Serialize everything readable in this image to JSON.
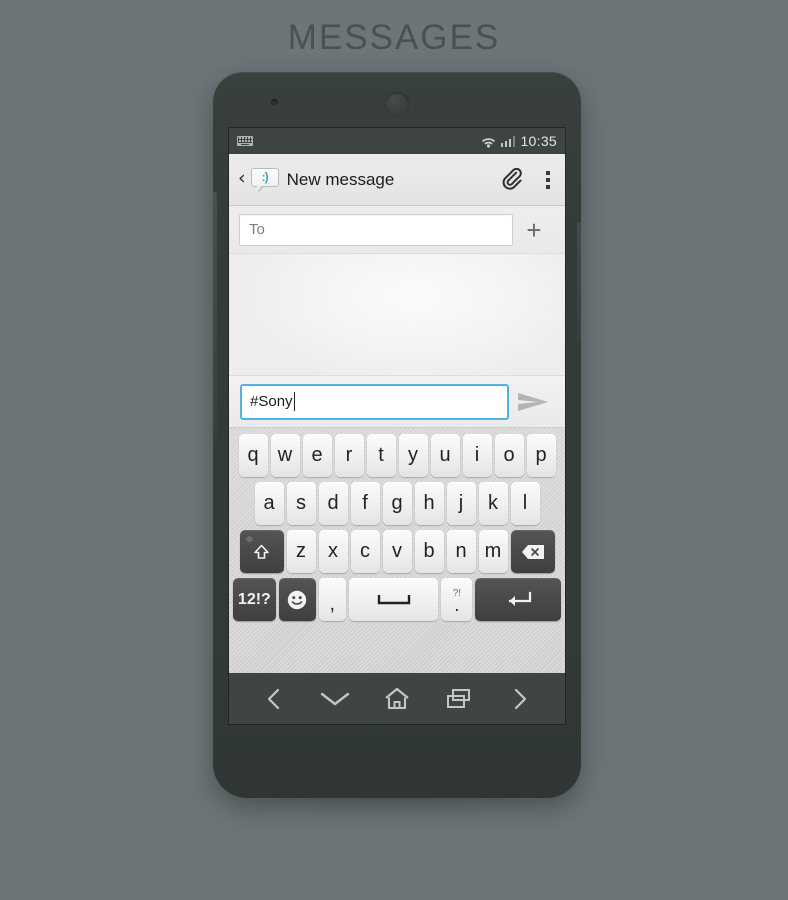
{
  "page": {
    "title": "MESSAGES",
    "background_color": "#6d7578",
    "phone_body_color": "#353c3a"
  },
  "statusbar": {
    "keyboard_icon": "keyboard-icon",
    "wifi_icon": "wifi-icon",
    "signal_icon": "signal-bars-icon",
    "time": "10:35"
  },
  "appbar": {
    "back_icon": "back-chevron-icon",
    "app_icon": "message-bubble-icon",
    "app_icon_face": ":)",
    "title": "New message",
    "attach_icon": "paperclip-icon",
    "overflow_icon": "overflow-menu-icon"
  },
  "recipient": {
    "placeholder": "To",
    "value": "",
    "add_contact_label": "+"
  },
  "compose": {
    "value": "#Sony",
    "send_icon": "send-arrow-icon",
    "accent_color": "#4fb3e8"
  },
  "keyboard": {
    "row1": [
      "q",
      "w",
      "e",
      "r",
      "t",
      "y",
      "u",
      "i",
      "o",
      "p"
    ],
    "row2": [
      "a",
      "s",
      "d",
      "f",
      "g",
      "h",
      "j",
      "k",
      "l"
    ],
    "row3": [
      "z",
      "x",
      "c",
      "v",
      "b",
      "n",
      "m"
    ],
    "shift_icon": "shift-arrow-icon",
    "backspace_icon": "backspace-icon",
    "symbols_label": "12!?",
    "emoji_icon": "smiley-icon",
    "comma_label": ",",
    "space_icon": "spacebar-icon",
    "period_top_label": "?!",
    "period_label": ".",
    "enter_icon": "enter-return-icon"
  },
  "navbar": {
    "back_icon": "nav-back-icon",
    "hide_keyboard_icon": "chevron-down-icon",
    "home_icon": "home-icon",
    "recents_icon": "recents-icon",
    "forward_icon": "nav-forward-icon"
  }
}
